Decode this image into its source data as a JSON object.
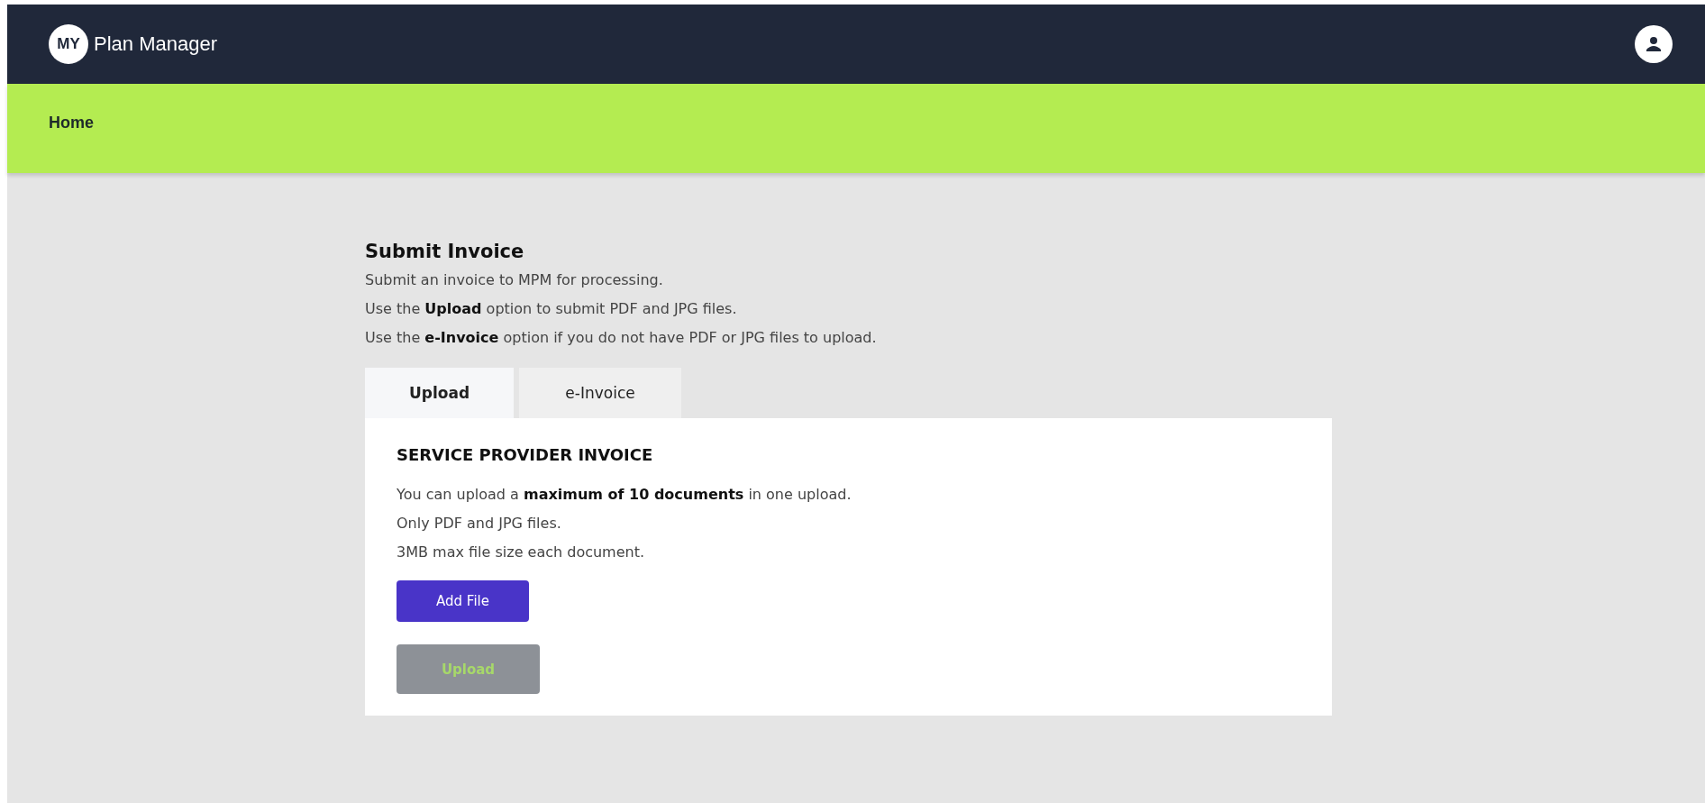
{
  "header": {
    "logo_badge": "MY",
    "logo_text": "Plan Manager"
  },
  "breadcrumb": "Home",
  "page": {
    "title": "Submit Invoice",
    "paragraphs": [
      "Submit an invoice to MPM for processing.",
      "Use the **Upload** option to submit PDF and JPG files.",
      "Use the **e-Invoice** option if you do not have PDF or JPG files to upload."
    ]
  },
  "tabs": [
    {
      "label": "Upload",
      "selected": true
    },
    {
      "label": "e-Invoice",
      "selected": false
    }
  ],
  "card": {
    "title": "SERVICE PROVIDER INVOICE",
    "paragraphs": [
      "You can upload a **maximum of 10 documents** in one upload.",
      "Only PDF and JPG files.",
      "3MB max file size each document."
    ],
    "buttons": [
      {
        "label": "Add File",
        "disabled": false
      },
      {
        "label": "Upload",
        "disabled": true
      }
    ]
  }
}
